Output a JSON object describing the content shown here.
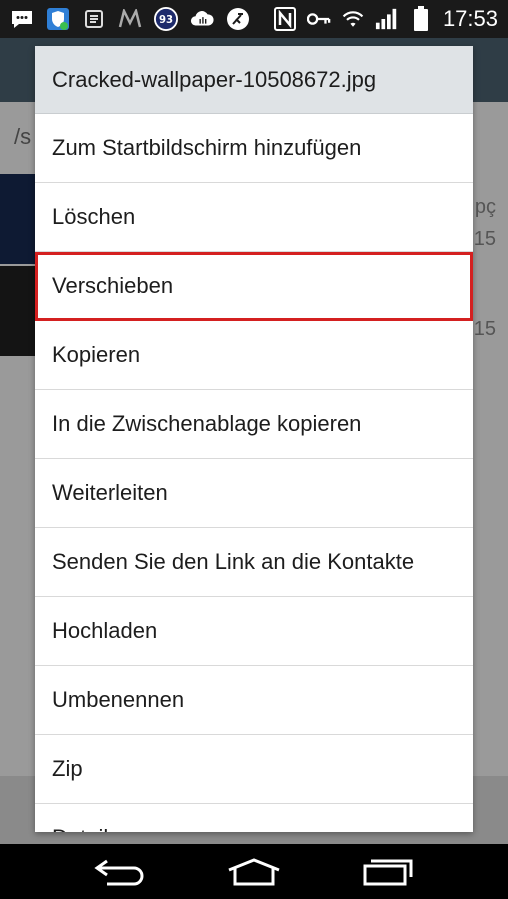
{
  "status_bar": {
    "time": "17:53",
    "badge_number": "93",
    "left_icons": [
      "message-icon",
      "shield-app-icon",
      "notes-icon",
      "m-app-icon",
      "badge-93-icon",
      "cloud-icon",
      "clean-icon"
    ],
    "right_icons": [
      "nfc-icon",
      "key-icon",
      "wifi-icon",
      "signal-icon",
      "battery-icon"
    ]
  },
  "background": {
    "path_fragment": "/s",
    "row1_fragment": "pç",
    "row1_sub": "15",
    "row2_sub": "15"
  },
  "dialog": {
    "title": "Cracked-wallpaper-10508672.jpg",
    "items": [
      {
        "label": "Zum Startbildschirm hinzufügen"
      },
      {
        "label": "Löschen"
      },
      {
        "label": "Verschieben",
        "highlighted": true
      },
      {
        "label": "Kopieren"
      },
      {
        "label": "In die Zwischenablage kopieren"
      },
      {
        "label": "Weiterleiten"
      },
      {
        "label": "Senden Sie den Link an die Kontakte"
      },
      {
        "label": "Hochladen"
      },
      {
        "label": "Umbenennen"
      },
      {
        "label": "Zip"
      },
      {
        "label": "Details"
      }
    ],
    "highlight_color": "#d42020"
  },
  "nav_bar": {
    "buttons": [
      "back-icon",
      "home-icon",
      "recents-icon"
    ]
  }
}
